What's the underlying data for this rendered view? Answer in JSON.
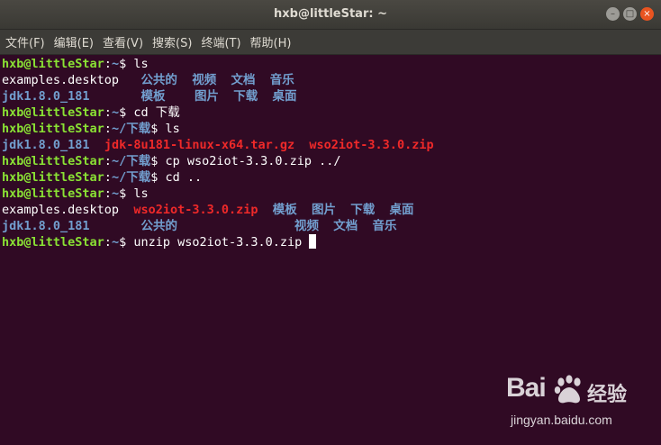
{
  "window": {
    "title": "hxb@littleStar: ~",
    "minimize_icon": "–",
    "maximize_icon": "□",
    "close_icon": "×"
  },
  "menu": [
    "文件(F)",
    "编辑(E)",
    "查看(V)",
    "搜索(S)",
    "终端(T)",
    "帮助(H)"
  ],
  "terminal": {
    "user_host": "hxb@littleStar",
    "colors": {
      "background": "#300a24",
      "prompt": "#8ae234",
      "directory": "#729fcf",
      "archive": "#ef2929",
      "text": "#ffffff"
    },
    "lines": [
      {
        "prompt": "hxb@littleStar",
        "sep": ":",
        "path": "~",
        "sigil": "$ ",
        "cmd": "ls"
      },
      {
        "files": [
          "examples.desktop",
          "公共的",
          "视频",
          "文档",
          "音乐"
        ]
      },
      {
        "files": [
          "jdk1.8.0_181",
          "模板",
          "图片",
          "下载",
          "桌面"
        ]
      },
      {
        "prompt": "hxb@littleStar",
        "sep": ":",
        "path": "~",
        "sigil": "$ ",
        "cmd": "cd 下载"
      },
      {
        "prompt": "hxb@littleStar",
        "sep": ":",
        "path": "~/下载",
        "sigil": "$ ",
        "cmd": "ls"
      },
      {
        "files": [
          "jdk1.8.0_181",
          "jdk-8u181-linux-x64.tar.gz",
          "wso2iot-3.3.0.zip"
        ]
      },
      {
        "prompt": "hxb@littleStar",
        "sep": ":",
        "path": "~/下载",
        "sigil": "$ ",
        "cmd": "cp wso2iot-3.3.0.zip ../"
      },
      {
        "prompt": "hxb@littleStar",
        "sep": ":",
        "path": "~/下载",
        "sigil": "$ ",
        "cmd": "cd .."
      },
      {
        "prompt": "hxb@littleStar",
        "sep": ":",
        "path": "~",
        "sigil": "$ ",
        "cmd": "ls"
      },
      {
        "files": [
          "examples.desktop",
          "wso2iot-3.3.0.zip",
          "模板",
          "图片",
          "下载",
          "桌面"
        ]
      },
      {
        "files": [
          "jdk1.8.0_181",
          "公共的",
          "视频",
          "文档",
          "音乐"
        ]
      },
      {
        "prompt": "hxb@littleStar",
        "sep": ":",
        "path": "~",
        "sigil": "$ ",
        "cmd": "unzip wso2iot-3.3.0.zip"
      }
    ]
  },
  "watermark": {
    "logo": "Bai",
    "logo_tail": "经验",
    "url": "jingyan.baidu.com"
  }
}
